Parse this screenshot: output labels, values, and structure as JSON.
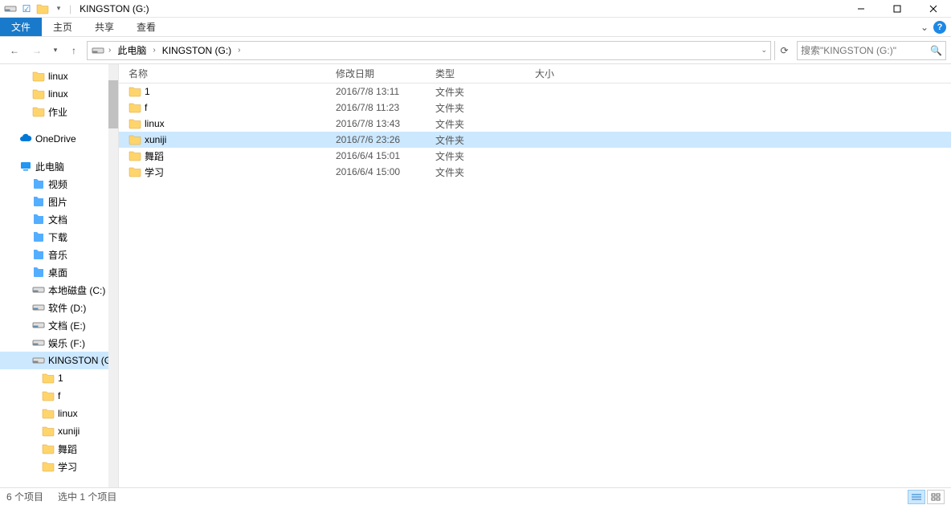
{
  "title": "KINGSTON (G:)",
  "ribbon": {
    "file": "文件",
    "home": "主页",
    "share": "共享",
    "view": "查看"
  },
  "breadcrumb": {
    "seg1": "此电脑",
    "seg2": "KINGSTON (G:)"
  },
  "search": {
    "placeholder": "搜索\"KINGSTON (G:)\""
  },
  "columns": {
    "name": "名称",
    "date": "修改日期",
    "type": "类型",
    "size": "大小"
  },
  "rows": [
    {
      "name": "1",
      "date": "2016/7/8 13:11",
      "type": "文件夹",
      "selected": false
    },
    {
      "name": "f",
      "date": "2016/7/8 11:23",
      "type": "文件夹",
      "selected": false
    },
    {
      "name": "linux",
      "date": "2016/7/8 13:43",
      "type": "文件夹",
      "selected": false
    },
    {
      "name": "xuniji",
      "date": "2016/7/6 23:26",
      "type": "文件夹",
      "selected": true
    },
    {
      "name": "舞蹈",
      "date": "2016/6/4 15:01",
      "type": "文件夹",
      "selected": false
    },
    {
      "name": "学习",
      "date": "2016/6/4 15:00",
      "type": "文件夹",
      "selected": false
    }
  ],
  "tree": {
    "qa_linux1": "linux",
    "qa_linux2": "linux",
    "qa_work": "作业",
    "onedrive": "OneDrive",
    "thispc": "此电脑",
    "videos": "视频",
    "pictures": "图片",
    "documents": "文档",
    "downloads": "下载",
    "music": "音乐",
    "desktop": "桌面",
    "drive_c": "本地磁盘 (C:)",
    "drive_d": "软件 (D:)",
    "drive_e": "文档 (E:)",
    "drive_f": "娱乐 (F:)",
    "kingston": "KINGSTON (G:)",
    "k_1": "1",
    "k_f": "f",
    "k_linux": "linux",
    "k_xuniji": "xuniji",
    "k_dance": "舞蹈",
    "k_study": "学习",
    "kingston2": "KINGSTON (G:)"
  },
  "status": {
    "count": "6 个项目",
    "selected": "选中 1 个项目"
  }
}
